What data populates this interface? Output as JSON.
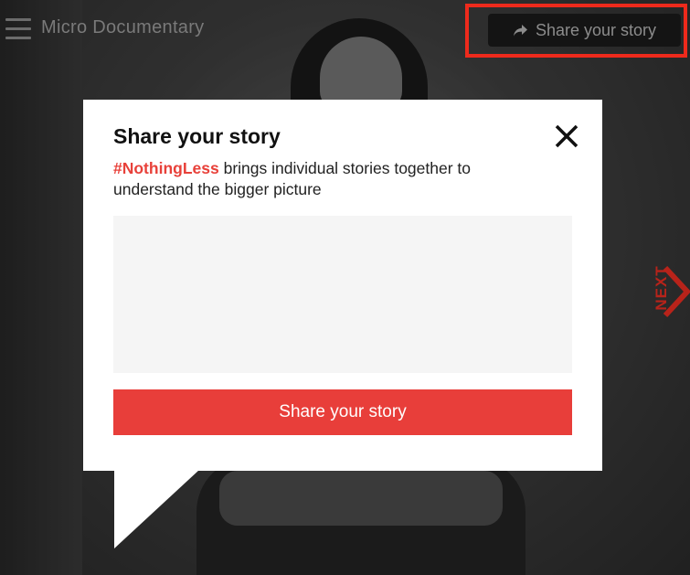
{
  "header": {
    "title": "Micro Documentary",
    "share_button_label": "Share your story",
    "share_icon": "share-arrow-icon",
    "menu_icon": "hamburger-menu-icon"
  },
  "navigation": {
    "next_label": "NEXT",
    "next_icon": "chevron-right-icon"
  },
  "modal": {
    "title": "Share your story",
    "hashtag": "#NothingLess",
    "description": " brings individual stories together to understand the bigger picture",
    "textarea_value": "",
    "submit_label": "Share your story",
    "close_icon": "close-icon"
  },
  "colors": {
    "accent": "#e83e3a",
    "highlight_border": "#ee2a1c",
    "next_color": "#b8231a"
  }
}
